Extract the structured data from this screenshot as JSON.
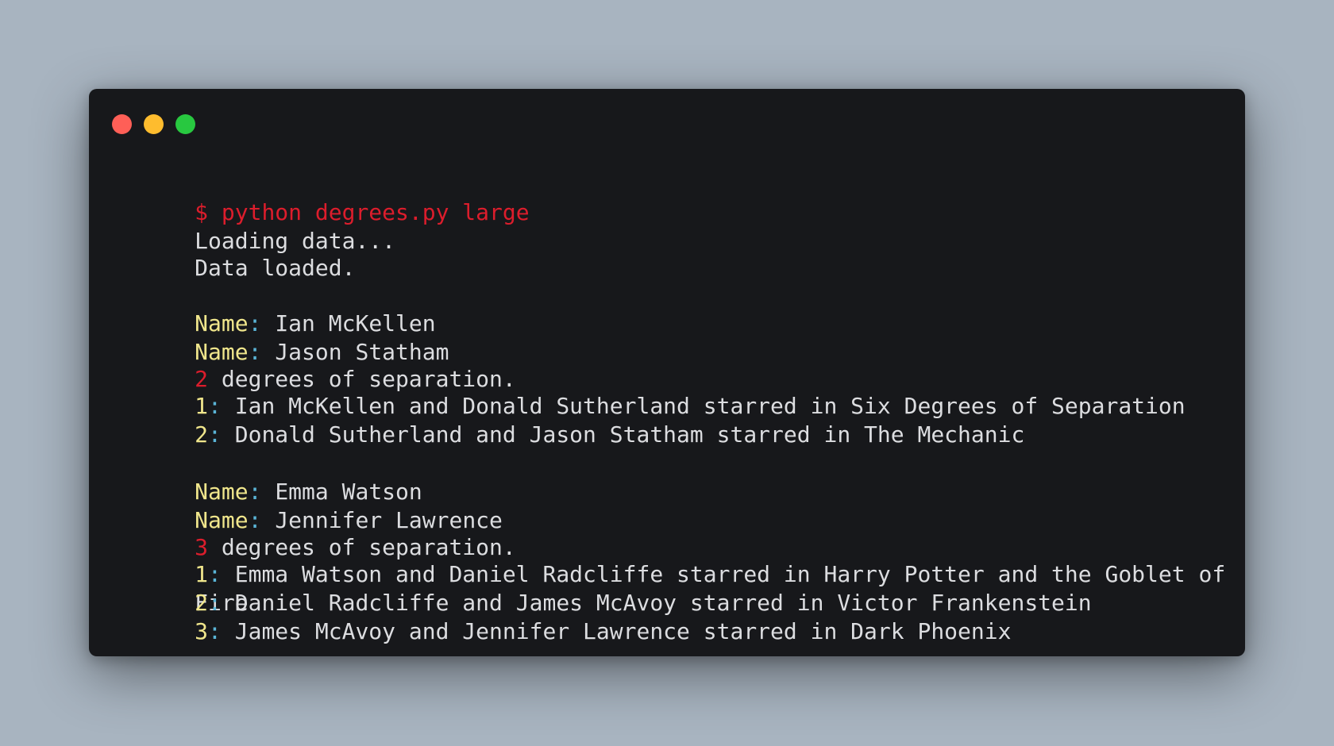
{
  "colors": {
    "background": "#a8b4c0",
    "window": "#17181b",
    "text": "#dcdde0",
    "prompt": "#dc1d2c",
    "label": "#f0e68c",
    "colon": "#5ab4d6",
    "number": "#dc1d2c",
    "close": "#ff5f57",
    "minimize": "#febc2e",
    "maximize": "#28c840"
  },
  "window_controls": [
    {
      "name": "close",
      "icon": "close-dot-icon"
    },
    {
      "name": "minimize",
      "icon": "minimize-dot-icon"
    },
    {
      "name": "maximize",
      "icon": "maximize-dot-icon"
    }
  ],
  "terminal": {
    "command": "$ python degrees.py large",
    "loading": "Loading data...",
    "loaded": "Data loaded.",
    "name_label": "Name",
    "colon": ": ",
    "degrees_text": " degrees of separation.",
    "query1": {
      "source": "Ian McKellen",
      "target": "Jason Statham",
      "degrees": "2",
      "steps": [
        {
          "n": "1",
          "text": "Ian McKellen and Donald Sutherland starred in Six Degrees of Separation"
        },
        {
          "n": "2",
          "text": "Donald Sutherland and Jason Statham starred in The Mechanic"
        }
      ]
    },
    "query2": {
      "source": "Emma Watson",
      "target": "Jennifer Lawrence",
      "degrees": "3",
      "steps": [
        {
          "n": "1",
          "text": "Emma Watson and Daniel Radcliffe starred in Harry Potter and the Goblet of"
        },
        {
          "n": "2",
          "text": "Daniel Radcliffe and James McAvoy starred in Victor Frankenstein"
        },
        {
          "n": "3",
          "text": "James McAvoy and Jennifer Lawrence starred in Dark Phoenix"
        }
      ],
      "wrap_overflow": "Fire"
    }
  }
}
